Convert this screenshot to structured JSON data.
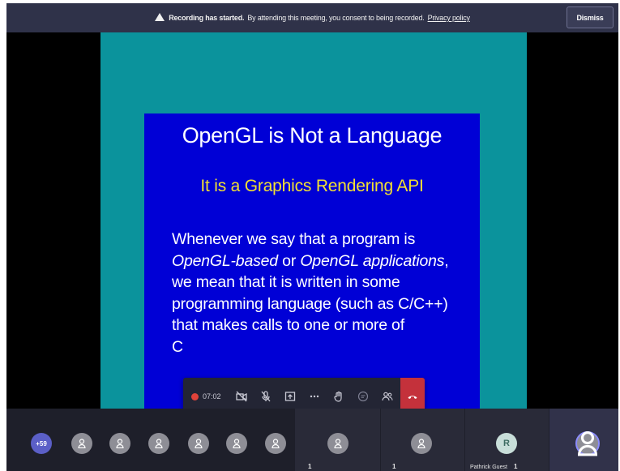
{
  "banner": {
    "bold": "Recording has started.",
    "text": "By attending this meeting, you consent to being recorded.",
    "link": "Privacy policy",
    "dismiss": "Dismiss"
  },
  "slide": {
    "title": "OpenGL is Not a Language",
    "subtitle": "It is a Graphics Rendering API",
    "body": {
      "l1": "Whenever we say that a program is",
      "l2_a": "OpenGL-based",
      "l2_b": " or ",
      "l2_c": "OpenGL applications",
      "l2_d": ",",
      "l3": "we mean that it is written in some",
      "l4": "programming language (such as C/C++)",
      "l5": "that makes calls to one or more of",
      "l6": "C"
    }
  },
  "controls": {
    "timer": "07:02",
    "icons": [
      "recording-dot",
      "camera-off-icon",
      "mic-off-icon",
      "share-icon",
      "more-icon",
      "raise-hand-icon",
      "chat-icon",
      "people-icon",
      "hang-up-icon"
    ]
  },
  "participants": {
    "more_count": "+59",
    "named_initial": "R",
    "named_label": "Pathrick Guest",
    "count_a": "1",
    "count_b": "1",
    "count_c": "1"
  },
  "colors": {
    "banner_bg": "#2f3249",
    "teal_bg": "#0b939c",
    "slide_bg": "#0000d6",
    "subtitle": "#f2e033",
    "hangup": "#c4313b",
    "more_badge": "#5b5fc7"
  }
}
